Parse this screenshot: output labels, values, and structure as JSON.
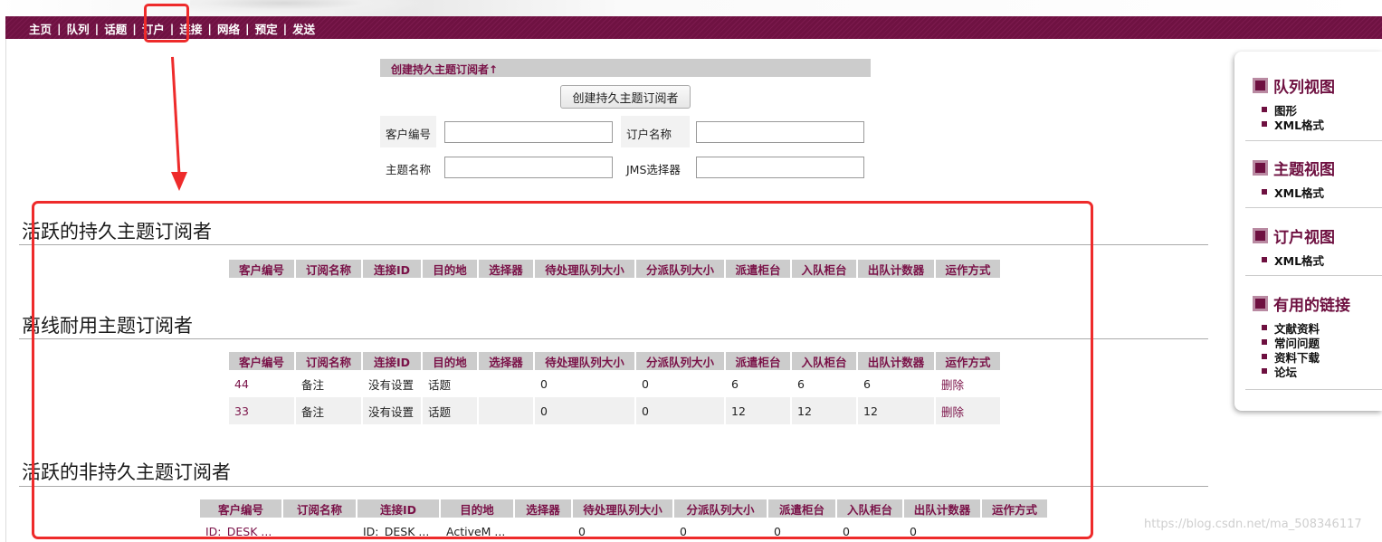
{
  "nav": {
    "items": [
      "主页",
      "队列",
      "话题",
      "订户",
      "连接",
      "网络",
      "预定",
      "发送"
    ],
    "separator": "|",
    "active": "订户"
  },
  "create_form": {
    "header": "创建持久主题订阅者↑",
    "button_label": "创建持久主题订阅者",
    "client_id_label": "客户编号",
    "client_id_value": "",
    "subscription_name_label": "订户名称",
    "subscription_name_value": "",
    "topic_name_label": "主题名称",
    "topic_name_value": "",
    "jms_selector_label": "JMS选择器",
    "jms_selector_value": ""
  },
  "sections": {
    "active_durable": {
      "title": "活跃的持久主题订阅者",
      "columns": [
        "客户编号",
        "订阅名称",
        "连接ID",
        "目的地",
        "选择器",
        "待处理队列大小",
        "分派队列大小",
        "派遣柜台",
        "入队柜台",
        "出队计数器",
        "运作方式"
      ],
      "rows": []
    },
    "offline_durable": {
      "title": "离线耐用主题订阅者",
      "columns": [
        "客户编号",
        "订阅名称",
        "连接ID",
        "目的地",
        "选择器",
        "待处理队列大小",
        "分派队列大小",
        "派遣柜台",
        "入队柜台",
        "出队计数器",
        "运作方式"
      ],
      "rows": [
        [
          "44",
          "备注",
          "没有设置",
          "话题",
          "",
          "0",
          "0",
          "6",
          "6",
          "6",
          "删除"
        ],
        [
          "33",
          "备注",
          "没有设置",
          "话题",
          "",
          "0",
          "0",
          "12",
          "12",
          "12",
          "删除"
        ]
      ]
    },
    "active_non_durable": {
      "title": "活跃的非持久主题订阅者",
      "columns": [
        "客户编号",
        "订阅名称",
        "连接ID",
        "目的地",
        "选择器",
        "待处理队列大小",
        "分派队列大小",
        "派遣柜台",
        "入队柜台",
        "出队计数器",
        "运作方式"
      ],
      "rows": [
        [
          "ID:_DESK ...",
          "",
          "ID:_DESK ...",
          "ActiveM ...",
          "",
          "0",
          "0",
          "0",
          "0",
          "0",
          ""
        ]
      ]
    }
  },
  "sidebar": {
    "queue_views": {
      "title": "队列视图",
      "items": [
        "图形",
        "XML格式"
      ]
    },
    "topic_views": {
      "title": "主题视图",
      "items": [
        "XML格式"
      ]
    },
    "subscriber_views": {
      "title": "订户视图",
      "items": [
        "XML格式"
      ]
    },
    "useful_links": {
      "title": "有用的链接",
      "items": [
        "文献资料",
        "常问问题",
        "资料下载",
        "论坛"
      ]
    }
  },
  "watermark": "https://blog.csdn.net/ma_508346117",
  "colors": {
    "brand": "#6e1040",
    "annotation": "#ee2b2b",
    "header_bg": "#cccccc"
  }
}
